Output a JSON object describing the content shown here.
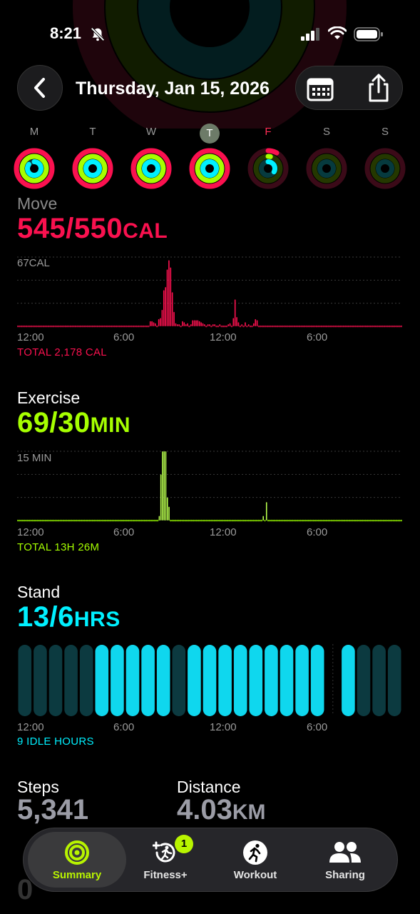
{
  "status_bar": {
    "time": "8:21"
  },
  "header": {
    "title": "Thursday, Jan 15, 2026"
  },
  "week": [
    {
      "letter": "M",
      "move": 1.0,
      "exercise": 1.0,
      "stand": 0.85,
      "state": "past"
    },
    {
      "letter": "T",
      "move": 1.0,
      "exercise": 1.0,
      "stand": 1.0,
      "state": "past"
    },
    {
      "letter": "W",
      "move": 1.0,
      "exercise": 1.0,
      "stand": 1.0,
      "state": "past"
    },
    {
      "letter": "T",
      "move": 0.99,
      "exercise": 1.0,
      "stand": 1.0,
      "state": "today"
    },
    {
      "letter": "F",
      "move": 0.08,
      "exercise": 0.03,
      "stand": 0.33,
      "state": "tomorrow"
    },
    {
      "letter": "S",
      "move": 0,
      "exercise": 0,
      "stand": 0,
      "state": "future"
    },
    {
      "letter": "S",
      "move": 0,
      "exercise": 0,
      "stand": 0,
      "state": "future"
    }
  ],
  "move": {
    "title": "Move",
    "value": "545/550",
    "unit": "CAL",
    "color": "#fa114f",
    "scale_label": "67CAL",
    "total": "TOTAL 2,178 CAL",
    "axis": [
      "12:00",
      "6:00",
      "12:00",
      "6:00"
    ]
  },
  "exercise": {
    "title": "Exercise",
    "value": "69/30",
    "unit": "MIN",
    "color": "#a6ff00",
    "scale_label": "15 MIN",
    "total": "TOTAL 13H 26M",
    "axis": [
      "12:00",
      "6:00",
      "12:00",
      "6:00"
    ]
  },
  "stand": {
    "title": "Stand",
    "value": "13/6",
    "unit": "HRS",
    "color": "#00f0ff",
    "total": "9 IDLE HOURS",
    "axis": [
      "12:00",
      "6:00",
      "12:00",
      "6:00"
    ]
  },
  "steps": {
    "label": "Steps",
    "value": "5,341"
  },
  "distance": {
    "label": "Distance",
    "value": "4.03",
    "unit": "KM"
  },
  "tabs": [
    {
      "label": "Summary",
      "icon": "summary-rings-icon",
      "active": true
    },
    {
      "label": "Fitness+",
      "icon": "fitness-plus-icon",
      "badge": "1"
    },
    {
      "label": "Workout",
      "icon": "workout-runner-icon"
    },
    {
      "label": "Sharing",
      "icon": "sharing-people-icon"
    }
  ],
  "chart_data": [
    {
      "type": "bar",
      "title": "Move",
      "ylabel": "CAL",
      "ylim": [
        0,
        67
      ],
      "x_labels": [
        "12:00",
        "6:00",
        "12:00",
        "6:00"
      ],
      "values": [
        0,
        0,
        0,
        0,
        0,
        0,
        0,
        0,
        0,
        0,
        0,
        0,
        0,
        0,
        0,
        0,
        0,
        0,
        0,
        0,
        0,
        0,
        0,
        0,
        0,
        0,
        0,
        0,
        0,
        0,
        0,
        0,
        0,
        0,
        0,
        0,
        0,
        0,
        0,
        0,
        0,
        0,
        0,
        0,
        0,
        0,
        0,
        0,
        0,
        0,
        0,
        0,
        0,
        0,
        0,
        0,
        0,
        0,
        0,
        0,
        0,
        0,
        0,
        0,
        0,
        0,
        0,
        0,
        0,
        0,
        0,
        0,
        0,
        0,
        0,
        0,
        0,
        0,
        5,
        5,
        4,
        3,
        0,
        7,
        8,
        16,
        35,
        38,
        55,
        64,
        57,
        33,
        14,
        3,
        2,
        1,
        0,
        5,
        4,
        1,
        3,
        0,
        1,
        6,
        6,
        6,
        6,
        5,
        4,
        3,
        2,
        0,
        2,
        1,
        0,
        1,
        1,
        0,
        0,
        1,
        0,
        0,
        0,
        0,
        1,
        3,
        0,
        8,
        26,
        9,
        4,
        0,
        1,
        0,
        4,
        0,
        2,
        0,
        0,
        3,
        7,
        6,
        0,
        0,
        0,
        0,
        0,
        0,
        0,
        0,
        0,
        0,
        0,
        0,
        0,
        0,
        0,
        0,
        0,
        0,
        0,
        0,
        0,
        0,
        0,
        0,
        0,
        0,
        0,
        0,
        0,
        0,
        0,
        0,
        0,
        0,
        0,
        0,
        0,
        0,
        0,
        0,
        0,
        0,
        0,
        0,
        0,
        0,
        0,
        0,
        0,
        0,
        0,
        0,
        0,
        0,
        0,
        0,
        0,
        0,
        0,
        0,
        0,
        0,
        0,
        0,
        0,
        0,
        0,
        0,
        0,
        0,
        0,
        0,
        0,
        0,
        0,
        0,
        0,
        0,
        0,
        0,
        0,
        0,
        0,
        0,
        0
      ]
    },
    {
      "type": "bar",
      "title": "Exercise",
      "ylabel": "MIN",
      "ylim": [
        0,
        15
      ],
      "x_labels": [
        "12:00",
        "6:00",
        "12:00",
        "6:00"
      ],
      "values": [
        0,
        0,
        0,
        0,
        0,
        0,
        0,
        0,
        0,
        0,
        0,
        0,
        0,
        0,
        0,
        0,
        0,
        0,
        0,
        0,
        0,
        0,
        0,
        0,
        0,
        0,
        0,
        0,
        0,
        0,
        0,
        0,
        0,
        0,
        0,
        0,
        0,
        0,
        0,
        0,
        0,
        0,
        0,
        0,
        0,
        0,
        0,
        0,
        0,
        0,
        0,
        0,
        0,
        0,
        0,
        0,
        0,
        0,
        0,
        0,
        0,
        0,
        0,
        0,
        0,
        0,
        0,
        0,
        0,
        0,
        0,
        0,
        0,
        0,
        0,
        0,
        0,
        0,
        0,
        0,
        0,
        0,
        0,
        0,
        0,
        0,
        0,
        1,
        10,
        15,
        15,
        15,
        5,
        3,
        0,
        0,
        0,
        0,
        0,
        0,
        0,
        0,
        0,
        0,
        0,
        0,
        0,
        0,
        0,
        0,
        0,
        0,
        0,
        0,
        0,
        0,
        0,
        0,
        0,
        0,
        0,
        0,
        0,
        0,
        0,
        0,
        0,
        0,
        0,
        0,
        0,
        0,
        0,
        0,
        0,
        0,
        0,
        0,
        0,
        0,
        0,
        0,
        0,
        0,
        0,
        0,
        0,
        0,
        0,
        0,
        0,
        1,
        0,
        4,
        0,
        0,
        0,
        0,
        0,
        0,
        0,
        0,
        0,
        0,
        0,
        0,
        0,
        0,
        0,
        0,
        0,
        0,
        0,
        0,
        0,
        0,
        0,
        0,
        0,
        0,
        0,
        0,
        0,
        0,
        0,
        0,
        0,
        0,
        0,
        0,
        0,
        0,
        0,
        0,
        0,
        0,
        0,
        0,
        0,
        0,
        0,
        0,
        0,
        0,
        0,
        0,
        0,
        0,
        0,
        0,
        0,
        0,
        0,
        0,
        0,
        0,
        0,
        0,
        0,
        0,
        0,
        0,
        0,
        0,
        0,
        0,
        0,
        0,
        0,
        0,
        0,
        0,
        0,
        0,
        0,
        0,
        0
      ]
    },
    {
      "type": "bar",
      "title": "Stand",
      "x_labels": [
        "12:00",
        "6:00",
        "12:00",
        "6:00"
      ],
      "values": [
        0,
        0,
        0,
        0,
        0,
        1,
        1,
        1,
        1,
        1,
        0,
        1,
        1,
        1,
        1,
        1,
        1,
        1,
        1,
        1,
        null,
        1,
        0,
        0,
        0
      ],
      "note": "1 = stood that hour, 0 = idle, null = no data"
    }
  ]
}
